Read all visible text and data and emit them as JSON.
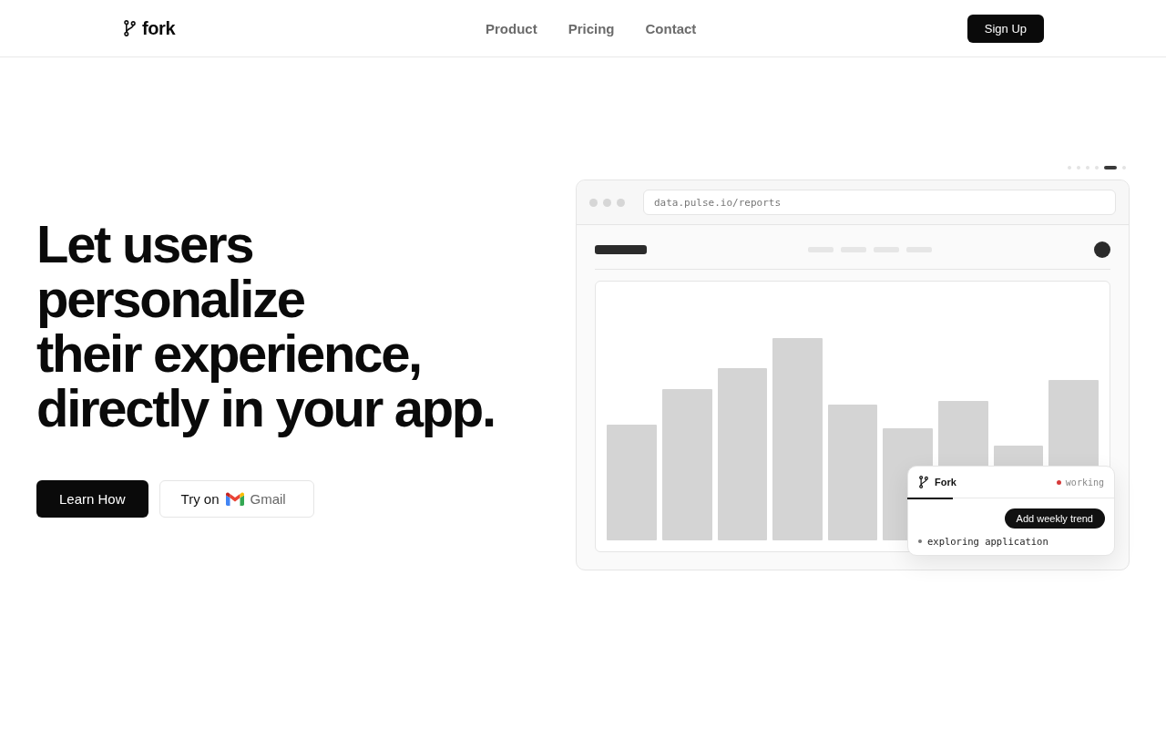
{
  "nav": {
    "logo": "fork",
    "links": [
      {
        "label": "Product"
      },
      {
        "label": "Pricing"
      },
      {
        "label": "Contact"
      }
    ],
    "signup": "Sign Up"
  },
  "hero": {
    "headline_lines": [
      "Let users",
      "personalize",
      "their experience,",
      "directly in your app."
    ],
    "primary_button": "Learn How",
    "secondary_button": {
      "label": "Try on",
      "app": "Gmail"
    }
  },
  "preview": {
    "slides": [
      {
        "selected": false
      },
      {
        "selected": false
      },
      {
        "selected": false
      },
      {
        "selected": false
      },
      {
        "selected": true
      },
      {
        "selected": false
      }
    ],
    "address": "data.pulse.io/reports",
    "assistant": {
      "title": "Fork",
      "status": "working",
      "message": "Add weekly trend",
      "activity": "exploring application"
    }
  }
}
